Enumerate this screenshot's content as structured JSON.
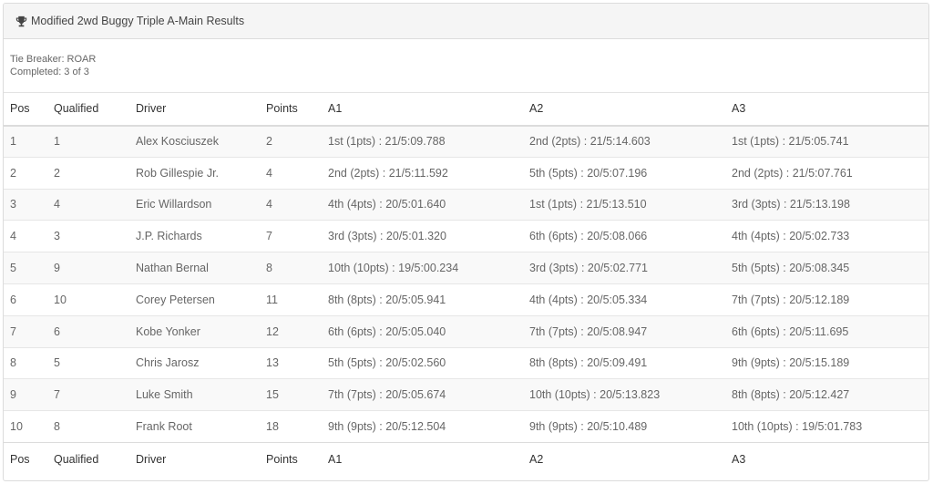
{
  "header": {
    "title": "Modified 2wd Buggy Triple A-Main Results",
    "icon": "trophy-icon"
  },
  "info": {
    "tie_breaker": "Tie Breaker: ROAR",
    "completed": "Completed: 3 of 3"
  },
  "columns": [
    "Pos",
    "Qualified",
    "Driver",
    "Points",
    "A1",
    "A2",
    "A3"
  ],
  "rows": [
    {
      "pos": "1",
      "qualified": "1",
      "driver": "Alex Kosciuszek",
      "points": "2",
      "a1": "1st (1pts) : 21/5:09.788",
      "a2": "2nd (2pts) : 21/5:14.603",
      "a3": "1st (1pts) : 21/5:05.741"
    },
    {
      "pos": "2",
      "qualified": "2",
      "driver": "Rob Gillespie Jr.",
      "points": "4",
      "a1": "2nd (2pts) : 21/5:11.592",
      "a2": "5th (5pts) : 20/5:07.196",
      "a3": "2nd (2pts) : 21/5:07.761"
    },
    {
      "pos": "3",
      "qualified": "4",
      "driver": "Eric Willardson",
      "points": "4",
      "a1": "4th (4pts) : 20/5:01.640",
      "a2": "1st (1pts) : 21/5:13.510",
      "a3": "3rd (3pts) : 21/5:13.198"
    },
    {
      "pos": "4",
      "qualified": "3",
      "driver": "J.P. Richards",
      "points": "7",
      "a1": "3rd (3pts) : 20/5:01.320",
      "a2": "6th (6pts) : 20/5:08.066",
      "a3": "4th (4pts) : 20/5:02.733"
    },
    {
      "pos": "5",
      "qualified": "9",
      "driver": "Nathan Bernal",
      "points": "8",
      "a1": "10th (10pts) : 19/5:00.234",
      "a2": "3rd (3pts) : 20/5:02.771",
      "a3": "5th (5pts) : 20/5:08.345"
    },
    {
      "pos": "6",
      "qualified": "10",
      "driver": "Corey Petersen",
      "points": "11",
      "a1": "8th (8pts) : 20/5:05.941",
      "a2": "4th (4pts) : 20/5:05.334",
      "a3": "7th (7pts) : 20/5:12.189"
    },
    {
      "pos": "7",
      "qualified": "6",
      "driver": "Kobe Yonker",
      "points": "12",
      "a1": "6th (6pts) : 20/5:05.040",
      "a2": "7th (7pts) : 20/5:08.947",
      "a3": "6th (6pts) : 20/5:11.695"
    },
    {
      "pos": "8",
      "qualified": "5",
      "driver": "Chris Jarosz",
      "points": "13",
      "a1": "5th (5pts) : 20/5:02.560",
      "a2": "8th (8pts) : 20/5:09.491",
      "a3": "9th (9pts) : 20/5:15.189"
    },
    {
      "pos": "9",
      "qualified": "7",
      "driver": "Luke Smith",
      "points": "15",
      "a1": "7th (7pts) : 20/5:05.674",
      "a2": "10th (10pts) : 20/5:13.823",
      "a3": "8th (8pts) : 20/5:12.427"
    },
    {
      "pos": "10",
      "qualified": "8",
      "driver": "Frank Root",
      "points": "18",
      "a1": "9th (9pts) : 20/5:12.504",
      "a2": "9th (9pts) : 20/5:10.489",
      "a3": "10th (10pts) : 19/5:01.783"
    }
  ]
}
